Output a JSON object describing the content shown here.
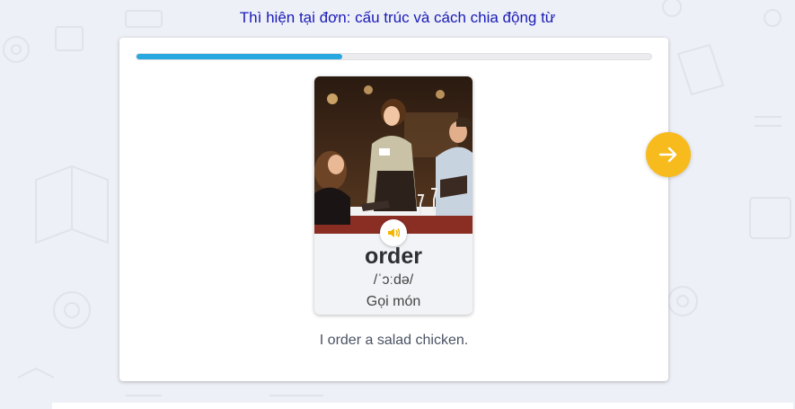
{
  "lesson": {
    "title": "Thì hiện tại đơn: cấu trúc và cách chia động từ"
  },
  "progress": {
    "fraction": 0.4
  },
  "flashcard": {
    "word": "order",
    "phonetic": "/ˈɔːdə/",
    "meaning": "Gọi món",
    "image_icon": "restaurant-ordering-photo",
    "audio_icon": "speaker-icon"
  },
  "example_sentence": "I order a salad chicken.",
  "navigation": {
    "next_icon": "arrow-right-icon"
  },
  "colors": {
    "background": "#edf0f6",
    "title": "#1a1ab8",
    "progress_fill": "#29a8e0",
    "next_button": "#f8bb1e",
    "audio_icon": "#f4b400"
  }
}
